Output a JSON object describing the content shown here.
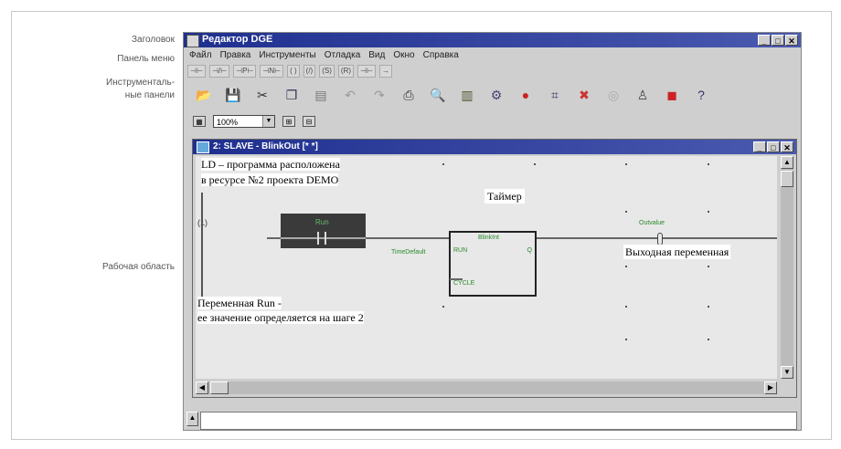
{
  "callouts": {
    "title": "Заголовок",
    "menu": "Панель меню",
    "toolbar_line1": "Инструменталь-",
    "toolbar_line2": "ные панели",
    "workarea": "Рабочая область"
  },
  "window": {
    "title": "Редактор DGE",
    "minimize": "_",
    "maximize": "□",
    "close": "✕"
  },
  "menu": [
    "Файл",
    "Правка",
    "Инструменты",
    "Отладка",
    "Вид",
    "Окно",
    "Справка"
  ],
  "ld_toolbar": [
    "⊣⊢",
    "⊣/⊢",
    "⊣P⊢",
    "⊣N⊢",
    "( )",
    "(/)",
    "(S)",
    "(R)",
    "⊣⊢",
    "→"
  ],
  "toolbar_icons": [
    "open-icon",
    "save-icon",
    "cut-icon",
    "copy-icon",
    "paste-icon",
    "undo-icon",
    "redo-icon",
    "print-icon",
    "find-icon",
    "library-icon",
    "compile-icon",
    "run-icon",
    "debug-icon",
    "breakpoint-icon",
    "watch-icon",
    "user-icon",
    "stop-icon",
    "help-icon"
  ],
  "zoom": {
    "value": "100%"
  },
  "child": {
    "title": "2: SLAVE - BlinkOut [* *]"
  },
  "diagram": {
    "run_label": "Run",
    "timer_type": "BlinkInt",
    "pin_run": "RUN",
    "pin_q": "Q",
    "pin_cycle": "CYCLE",
    "const_label": "TimeDefault",
    "output_label": "Outvalue",
    "rung_label": "(1)",
    "colors": {
      "label_green": "#2a8a2a",
      "block_dark": "#3a3a3a"
    }
  },
  "annotations": {
    "ld_line1": "LD – программа расположена",
    "ld_line2": "в ресурсе №2 проекта DEMO",
    "timer": "Таймер",
    "output": "Выходная переменная",
    "run_line1": "Переменная Run -",
    "run_line2": "ее значение определяется на шаге 2"
  }
}
